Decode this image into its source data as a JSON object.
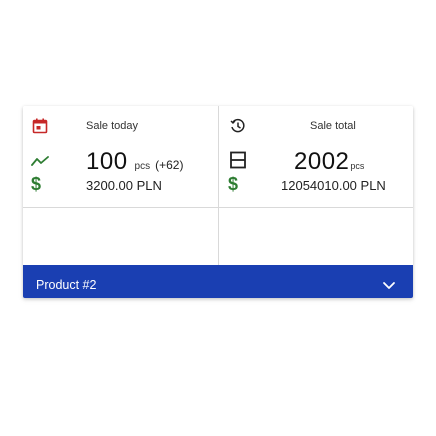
{
  "stats": {
    "left": {
      "label": "Sale today",
      "value": "100",
      "unit": "pcs",
      "delta": "(+62)",
      "money_icon_symbol": "$",
      "money": "3200.00 PLN"
    },
    "right": {
      "label": "Sale total",
      "value": "2002",
      "unit": "pcs",
      "money_icon_symbol": "$",
      "money": "12054010.00 PLN"
    }
  },
  "footer": {
    "label": "Product #2",
    "icon": "chevron-down-icon"
  },
  "colors": {
    "accent": "#1a3fb2",
    "trend_green": "#2e7d32",
    "calendar_red": "#c62828",
    "divider": "#d9d9d9"
  }
}
